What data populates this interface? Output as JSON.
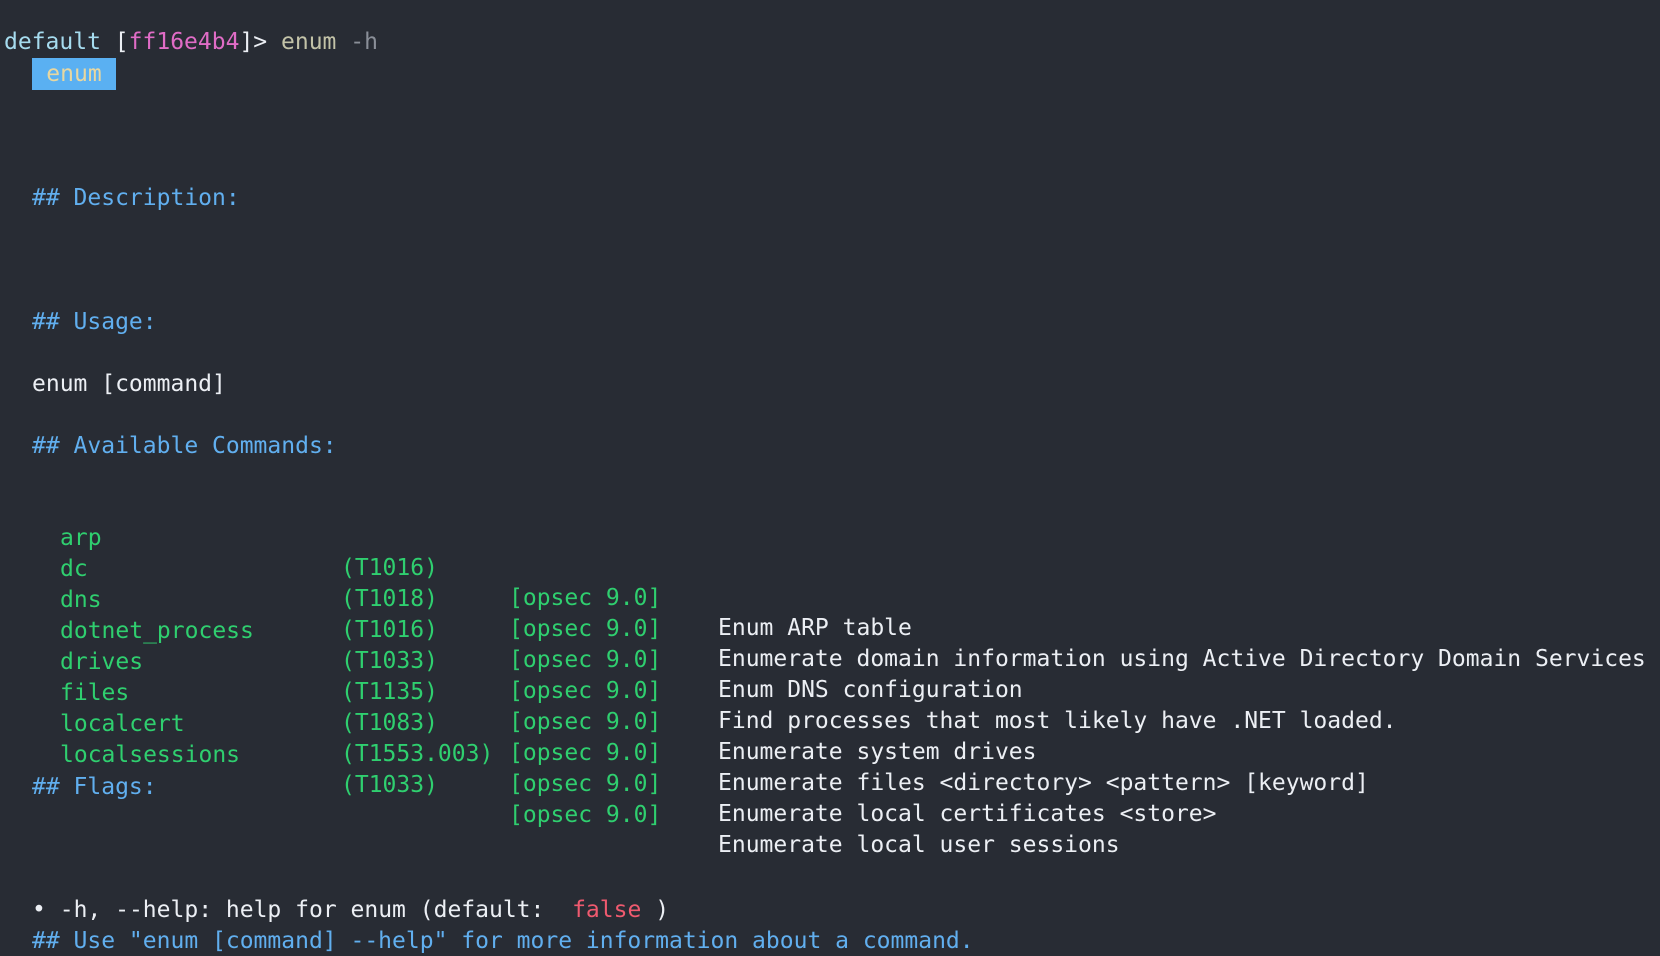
{
  "prompt": {
    "context": "default",
    "bracket_open": "[",
    "session_id": "ff16e4b4",
    "bracket_close": "]",
    "caret": ">",
    "command": "enum",
    "flag": "-h"
  },
  "badge": "enum",
  "headings": {
    "description": "## Description:",
    "usage": "## Usage:",
    "available": "## Available Commands:",
    "flags": "## Flags:",
    "footer": "## Use \"enum [command] --help\" for more information about a command."
  },
  "usage_line": "enum [command]",
  "commands": [
    {
      "name": "arp",
      "tid": "(T1016)",
      "opsec": "[opsec 9.0]",
      "desc": "Enum ARP table"
    },
    {
      "name": "dc",
      "tid": "(T1018)",
      "opsec": "[opsec 9.0]",
      "desc": "Enumerate domain information using Active Directory Domain Services"
    },
    {
      "name": "dns",
      "tid": "(T1016)",
      "opsec": "[opsec 9.0]",
      "desc": "Enum DNS configuration"
    },
    {
      "name": "dotnet_process",
      "tid": "(T1033)",
      "opsec": "[opsec 9.0]",
      "desc": "Find processes that most likely have .NET loaded."
    },
    {
      "name": "drives",
      "tid": "(T1135)",
      "opsec": "[opsec 9.0]",
      "desc": "Enumerate system drives"
    },
    {
      "name": "files",
      "tid": "(T1083)",
      "opsec": "[opsec 9.0]",
      "desc": "Enumerate files <directory> <pattern> [keyword]"
    },
    {
      "name": "localcert",
      "tid": "(T1553.003)",
      "opsec": "[opsec 9.0]",
      "desc": "Enumerate local certificates <store>"
    },
    {
      "name": "localsessions",
      "tid": "(T1033)",
      "opsec": "[opsec 9.0]",
      "desc": "Enumerate local user sessions"
    }
  ],
  "flag_item": {
    "bullet": "•",
    "text": "-h, --help: help for enum (default:",
    "default_value": "false",
    "close": ")"
  },
  "colors": {
    "background": "#282c34",
    "heading": "#61afef",
    "command_name": "#2fcf6f",
    "badge_bg": "#5ab0f2",
    "false_value": "#ef5a6f",
    "session_id": "#e06cc6"
  }
}
